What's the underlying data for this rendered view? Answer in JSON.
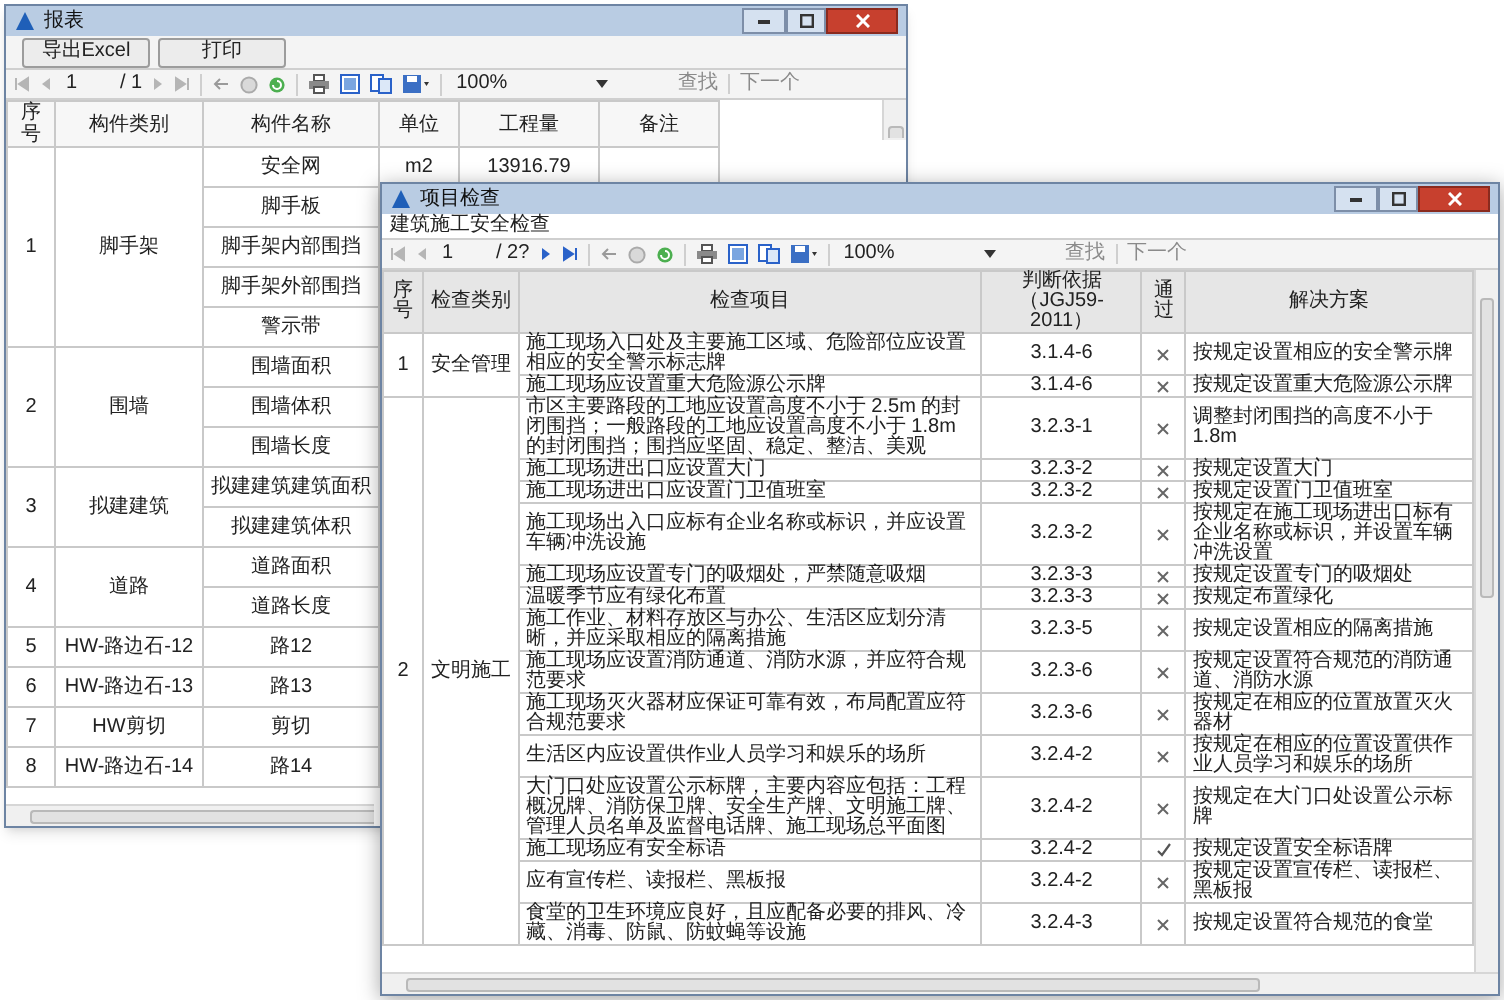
{
  "report": {
    "title": "报表",
    "buttons": [
      "导出Excel",
      "打印"
    ],
    "toolbar": {
      "page": "1",
      "page_total": "/ 1",
      "next_enabled": false,
      "zoom": "100%",
      "find": "查找",
      "find_next": "下一个"
    },
    "columns": [
      "序号",
      "构件类别",
      "构件名称",
      "单位",
      "工程量",
      "备注"
    ],
    "groups": [
      {
        "no": "1",
        "category": "脚手架",
        "items": [
          {
            "name": "安全网",
            "unit": "m2",
            "quantity": "13916.79"
          },
          {
            "name": "脚手板"
          },
          {
            "name": "脚手架内部围挡"
          },
          {
            "name": "脚手架外部围挡"
          },
          {
            "name": "警示带"
          }
        ]
      },
      {
        "no": "2",
        "category": "围墙",
        "items": [
          {
            "name": "围墙面积"
          },
          {
            "name": "围墙体积"
          },
          {
            "name": "围墙长度"
          }
        ]
      },
      {
        "no": "3",
        "category": "拟建建筑",
        "items": [
          {
            "name": "拟建建筑建筑面积"
          },
          {
            "name": "拟建建筑体积"
          }
        ]
      },
      {
        "no": "4",
        "category": "道路",
        "items": [
          {
            "name": "道路面积"
          },
          {
            "name": "道路长度"
          }
        ]
      },
      {
        "no": "5",
        "category": "HW-路边石-12",
        "items": [
          {
            "name": "路12"
          }
        ]
      },
      {
        "no": "6",
        "category": "HW-路边石-13",
        "items": [
          {
            "name": "路13"
          }
        ]
      },
      {
        "no": "7",
        "category": "HW剪切",
        "items": [
          {
            "name": "剪切"
          }
        ]
      },
      {
        "no": "8",
        "category": "HW-路边石-14",
        "items": [
          {
            "name": "路14"
          }
        ]
      }
    ]
  },
  "inspection": {
    "title": "项目检查",
    "subtitle": "建筑施工安全检查",
    "toolbar": {
      "page": "1",
      "page_total": "/ 2?",
      "next_enabled": true,
      "zoom": "100%",
      "find": "查找",
      "find_next": "下一个"
    },
    "columns": [
      "序号",
      "检查类别",
      "检查项目",
      "判断依据（JGJ59-2011）",
      "通过",
      "解决方案"
    ],
    "groups": [
      {
        "no": "1",
        "category": "安全管理",
        "items": [
          {
            "item": "施工现场入口处及主要施工区域、危险部位应设置相应的安全警示标志牌",
            "basis": "3.1.4-6",
            "passed": false,
            "solution": "按规定设置相应的安全警示牌"
          },
          {
            "item": "施工现场应设置重大危险源公示牌",
            "basis": "3.1.4-6",
            "passed": false,
            "solution": "按规定设置重大危险源公示牌"
          }
        ]
      },
      {
        "no": "2",
        "category": "文明施工",
        "items": [
          {
            "item": "市区主要路段的工地应设置高度不小于 2.5m 的封闭围挡；一般路段的工地应设置高度不小于 1.8m 的封闭围挡；围挡应坚固、稳定、整洁、美观",
            "basis": "3.2.3-1",
            "passed": false,
            "solution": "调整封闭围挡的高度不小于1.8m"
          },
          {
            "item": "施工现场进出口应设置大门",
            "basis": "3.2.3-2",
            "passed": false,
            "solution": "按规定设置大门"
          },
          {
            "item": "施工现场进出口应设置门卫值班室",
            "basis": "3.2.3-2",
            "passed": false,
            "solution": "按规定设置门卫值班室"
          },
          {
            "item": "施工现场出入口应标有企业名称或标识，并应设置车辆冲洗设施",
            "basis": "3.2.3-2",
            "passed": false,
            "solution": "按规定在施工现场进出口标有企业名称或标识，并设置车辆冲洗设置"
          },
          {
            "item": "施工现场应设置专门的吸烟处，严禁随意吸烟",
            "basis": "3.2.3-3",
            "passed": false,
            "solution": "按规定设置专门的吸烟处"
          },
          {
            "item": "温暖季节应有绿化布置",
            "basis": "3.2.3-3",
            "passed": false,
            "solution": "按规定布置绿化"
          },
          {
            "item": "施工作业、材料存放区与办公、生活区应划分清晰，并应采取相应的隔离措施",
            "basis": "3.2.3-5",
            "passed": false,
            "solution": "按规定设置相应的隔离措施"
          },
          {
            "item": "施工现场应设置消防通道、消防水源，并应符合规范要求",
            "basis": "3.2.3-6",
            "passed": false,
            "solution": "按规定设置符合规范的消防通道、消防水源"
          },
          {
            "item": "施工现场灭火器材应保证可靠有效，布局配置应符合规范要求",
            "basis": "3.2.3-6",
            "passed": false,
            "solution": "按规定在相应的位置放置灭火器材"
          },
          {
            "item": "生活区内应设置供作业人员学习和娱乐的场所",
            "basis": "3.2.4-2",
            "passed": false,
            "solution": "按规定在相应的位置设置供作业人员学习和娱乐的场所"
          },
          {
            "item": "大门口处应设置公示标牌，主要内容应包括：工程概况牌、消防保卫牌、安全生产牌、文明施工牌、管理人员名单及监督电话牌、施工现场总平面图",
            "basis": "3.2.4-2",
            "passed": false,
            "solution": "按规定在大门口处设置公示标牌"
          },
          {
            "item": "施工现场应有安全标语",
            "basis": "3.2.4-2",
            "passed": true,
            "solution": "按规定设置安全标语牌"
          },
          {
            "item": "应有宣传栏、读报栏、黑板报",
            "basis": "3.2.4-2",
            "passed": false,
            "solution": "按规定设置宣传栏、读报栏、黑板报"
          },
          {
            "item": "食堂的卫生环境应良好，且应配备必要的排风、冷藏、消毒、防鼠、防蚊蝇等设施",
            "basis": "3.2.4-3",
            "passed": false,
            "solution": "按规定设置符合规范的食堂"
          }
        ]
      }
    ]
  }
}
